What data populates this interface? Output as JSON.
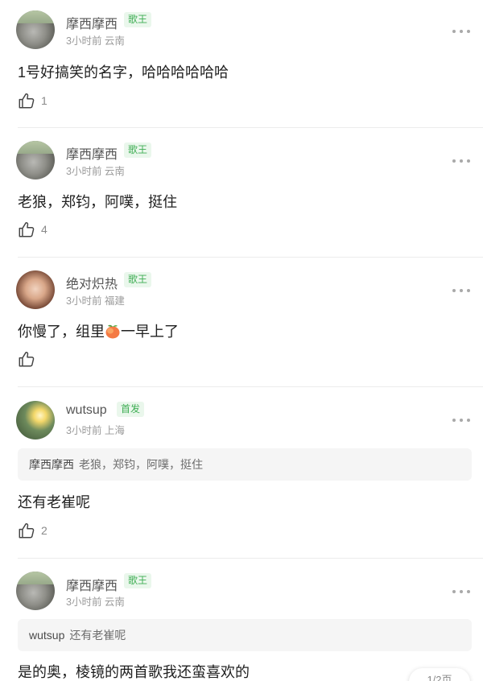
{
  "comments": [
    {
      "name": "摩西摩西",
      "badge": "歌王",
      "meta": "3小时前 云南",
      "text": "1号好搞笑的名字，哈哈哈哈哈哈",
      "likes": "1"
    },
    {
      "name": "摩西摩西",
      "badge": "歌王",
      "meta": "3小时前 云南",
      "text": "老狼，郑钧，阿噗，挺住",
      "likes": "4"
    },
    {
      "name": "绝对炽热",
      "badge": "歌王",
      "meta": "3小时前 福建",
      "text_before": "你慢了，组里",
      "text_after": "一早上了",
      "emoji_icon": "peach-emoji",
      "likes": ""
    },
    {
      "name": "wutsup",
      "badge": "首发",
      "meta": "3小时前 上海",
      "quote_name": "摩西摩西",
      "quote_text": "老狼，郑钧，阿噗，挺住",
      "text": "还有老崔呢",
      "likes": "2"
    },
    {
      "name": "摩西摩西",
      "badge": "歌王",
      "meta": "3小时前 云南",
      "quote_name": "wutsup",
      "quote_text": "还有老崔呢",
      "text": "是的奥，棱镜的两首歌我还蛮喜欢的"
    }
  ],
  "pager": {
    "label": "1/2页"
  },
  "colors": {
    "badge_green": "#3fae54",
    "badge_bg": "#eaf7ec",
    "meta_gray": "#9b9b9b"
  },
  "icons": {
    "like": "thumbs-up-icon",
    "more": "more-dots-icon"
  }
}
